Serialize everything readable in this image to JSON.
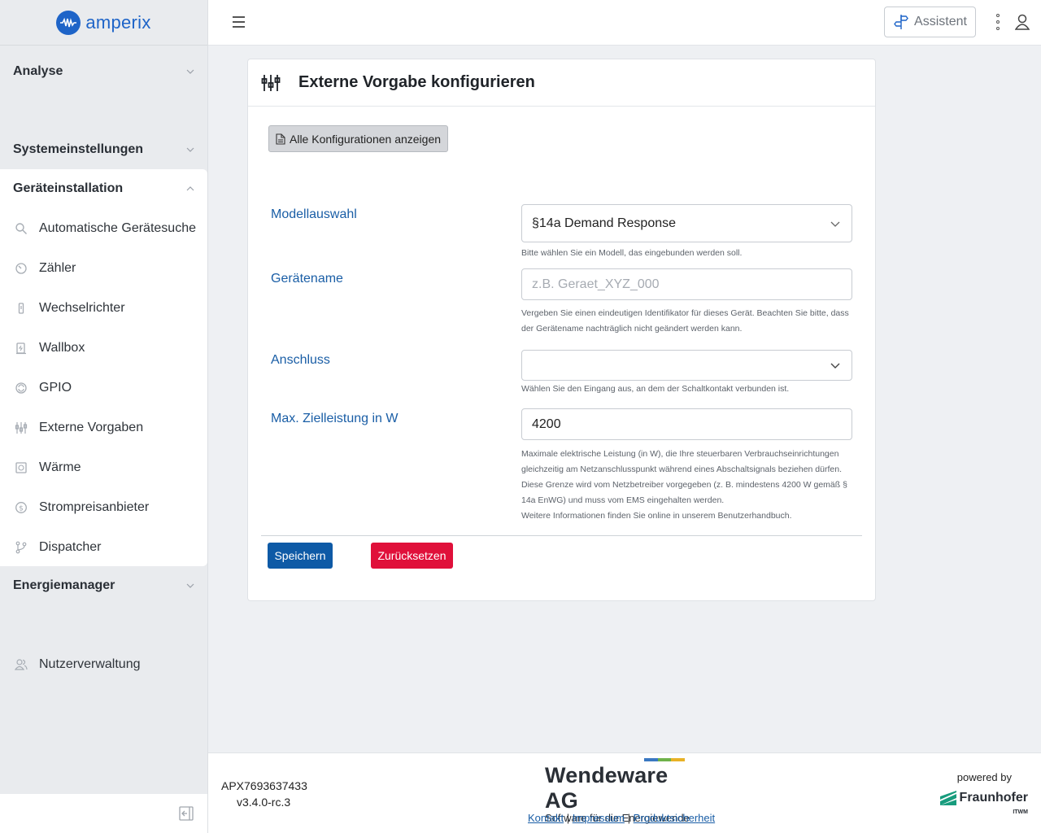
{
  "brand": {
    "name": "amperix",
    "color": "#1e64c8"
  },
  "sidebar": {
    "sections": [
      {
        "label": "Analyse",
        "expanded": false
      },
      {
        "label": "Systemeinstellungen",
        "expanded": false
      },
      {
        "label": "Geräteinstallation",
        "expanded": true
      },
      {
        "label": "Energiemanager",
        "expanded": false
      }
    ],
    "items": [
      {
        "label": "Automatische Gerätesuche",
        "icon": "search-icon"
      },
      {
        "label": "Zähler",
        "icon": "meter-icon"
      },
      {
        "label": "Wechselrichter",
        "icon": "inverter-icon"
      },
      {
        "label": "Wallbox",
        "icon": "wallbox-icon"
      },
      {
        "label": "GPIO",
        "icon": "gpio-icon"
      },
      {
        "label": "Externe Vorgaben",
        "icon": "sliders-icon"
      },
      {
        "label": "Wärme",
        "icon": "heat-icon"
      },
      {
        "label": "Strompreisanbieter",
        "icon": "dollar-icon"
      },
      {
        "label": "Dispatcher",
        "icon": "branch-icon"
      }
    ],
    "user_mgmt": {
      "label": "Nutzerverwaltung",
      "icon": "users-icon"
    }
  },
  "topbar": {
    "assistant_label": "Assistent"
  },
  "card": {
    "title": "Externe Vorgabe konfigurieren",
    "show_all_label": "Alle Konfigurationen anzeigen",
    "fields": {
      "model": {
        "label": "Modellauswahl",
        "value": "§14a Demand Response",
        "help": "Bitte wählen Sie ein Modell, das eingebunden werden soll."
      },
      "device_name": {
        "label": "Gerätename",
        "placeholder": "z.B. Geraet_XYZ_000",
        "help1": "Vergeben Sie einen eindeutigen Identifikator für dieses Gerät. Beachten Sie bitte, dass",
        "help2": "der Gerätename nachträglich nicht geändert werden kann."
      },
      "connection": {
        "label": "Anschluss",
        "value": "",
        "help": "Wählen Sie den Eingang aus, an dem der Schaltkontakt verbunden ist."
      },
      "max_power": {
        "label": "Max. Zielleistung in W",
        "value": "4200",
        "help1": "Maximale elektrische Leistung (in W), die Ihre steuerbaren Verbrauchseinrichtungen",
        "help2": "gleichzeitig am Netzanschlusspunkt während eines Abschaltsignals beziehen dürfen.",
        "help3": "Diese Grenze wird vom Netzbetreiber vorgegeben (z. B. mindestens 4200 W gemäß §",
        "help4": "14a EnWG) und muss vom EMS eingehalten werden.",
        "help5": "Weitere Informationen finden Sie online in unserem Benutzerhandbuch."
      }
    },
    "save_label": "Speichern",
    "reset_label": "Zurücksetzen",
    "save_color": "#0e5aa6",
    "reset_color": "#e0103a"
  },
  "footer": {
    "device_id": "APX7693637433",
    "version": "v3.4.0-rc.3",
    "company": "Wendeware AG",
    "tagline": "Software für die Energiewende",
    "links": [
      "Kontakt",
      "Impressum",
      "Produktsicherheit"
    ],
    "powered_by": "powered by",
    "partner": "Fraunhofer",
    "partner_unit": "ITWM"
  }
}
